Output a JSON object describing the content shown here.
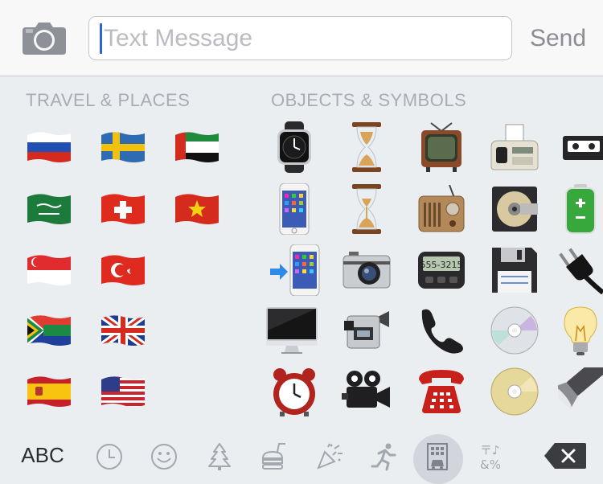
{
  "message_bar": {
    "placeholder": "Text Message",
    "value": "",
    "send_label": "Send",
    "camera_icon": "camera-icon"
  },
  "sections": {
    "travel_places": "TRAVEL & PLACES",
    "objects_symbols": "OBJECTS & SYMBOLS"
  },
  "travel_places_emojis": [
    "russia-flag",
    "sweden-flag",
    "uae-flag",
    "saudi-arabia-flag",
    "switzerland-flag",
    "vietnam-flag",
    "singapore-flag",
    "turkey-flag",
    "south-africa-flag",
    "united-kingdom-flag",
    "spain-flag",
    "united-states-flag"
  ],
  "objects_symbols_emojis": [
    "watch",
    "hourglass",
    "television",
    "fax-machine",
    "videocassette",
    "mobile-phone",
    "hourglass-flowing",
    "radio",
    "minidisc",
    "battery",
    "mobile-phone-with-arrow",
    "camera",
    "pager",
    "floppy-disk",
    "electric-plug",
    "desktop-computer",
    "video-camera",
    "telephone-receiver",
    "optical-disc",
    "light-bulb",
    "alarm-clock",
    "movie-camera",
    "telephone",
    "dvd",
    "flashlight"
  ],
  "pager_display": "555-3215",
  "bottom_bar": {
    "abc_label": "ABC",
    "tabs": [
      "recent",
      "smileys-people",
      "animals-nature",
      "food-drink",
      "celebration",
      "activity",
      "travel-places",
      "symbols"
    ],
    "active_tab": "travel-places",
    "symbols_tab_glyphs": "〒♪&%"
  },
  "colors": {
    "cursor": "#2a66d8",
    "section_title": "#a8acb3",
    "send": "#8a8e94"
  }
}
